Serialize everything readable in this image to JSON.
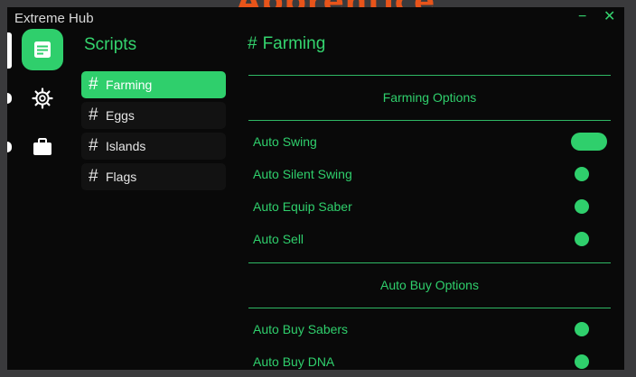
{
  "background": {
    "game_title": "Apprentice"
  },
  "window": {
    "title": "Extreme Hub",
    "minimize": "−",
    "close": "✕"
  },
  "rail": {
    "items": [
      {
        "icon": "document-icon",
        "active": true
      },
      {
        "icon": "gear-icon",
        "active": false
      },
      {
        "icon": "briefcase-icon",
        "active": false
      }
    ]
  },
  "sidebar": {
    "title": "Scripts",
    "hash": "#",
    "items": [
      {
        "label": "Farming",
        "active": true
      },
      {
        "label": "Eggs",
        "active": false
      },
      {
        "label": "Islands",
        "active": false
      },
      {
        "label": "Flags",
        "active": false
      }
    ]
  },
  "content": {
    "title_hash": "#",
    "title": "Farming",
    "sections": [
      {
        "heading": "Farming Options",
        "rows": [
          {
            "label": "Auto Swing",
            "toggle": "pill"
          },
          {
            "label": "Auto Silent Swing",
            "toggle": "dot"
          },
          {
            "label": "Auto Equip Saber",
            "toggle": "dot"
          },
          {
            "label": "Auto Sell",
            "toggle": "dot"
          }
        ]
      },
      {
        "heading": "Auto Buy Options",
        "rows": [
          {
            "label": "Auto Buy Sabers",
            "toggle": "dot"
          },
          {
            "label": "Auto Buy DNA",
            "toggle": "dot"
          }
        ]
      }
    ]
  },
  "colors": {
    "accent": "#2fcf6c",
    "window_bg": "#090909",
    "item_bg": "#121212",
    "background_title": "#e8541a"
  }
}
